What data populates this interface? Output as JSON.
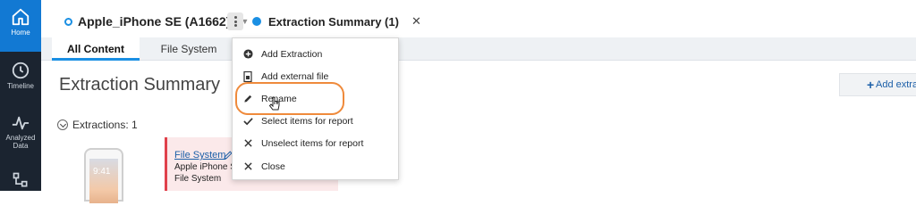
{
  "rail": {
    "items": [
      {
        "label": "Home",
        "icon": "home-icon",
        "active": true
      },
      {
        "label": "Timeline",
        "icon": "clock-icon",
        "active": false
      },
      {
        "label": "Analyzed Data",
        "icon": "pulse-icon",
        "active": false
      },
      {
        "label": "",
        "icon": "hierarchy-icon",
        "active": false
      }
    ]
  },
  "topbar": {
    "device_tab": "Apple_iPhone SE (A1662)",
    "summary_tab": "Extraction Summary (1)",
    "close": "✕"
  },
  "subtabs": {
    "all_content": "All Content",
    "file_system": "File System"
  },
  "main": {
    "title": "Extraction Summary",
    "add_button": "Add extra",
    "extractions_label": "Extractions: 1",
    "phone_time": "9:41"
  },
  "card": {
    "link": "File System",
    "line1": "Apple iPhone S",
    "line2": "File System"
  },
  "menu": {
    "items": [
      {
        "label": "Add Extraction",
        "icon": "plus-circle-icon"
      },
      {
        "label": "Add external file",
        "icon": "file-add-icon"
      },
      {
        "label": "Rename",
        "icon": "pencil-icon"
      },
      {
        "label": "Select items for report",
        "icon": "check-icon"
      },
      {
        "label": "Unselect items for report",
        "icon": "x-icon"
      },
      {
        "label": "Close",
        "icon": "x-icon"
      }
    ]
  },
  "colors": {
    "accent": "#1a8fe3",
    "rail_bg": "#1b2430",
    "rail_active": "#1279d3",
    "highlight_ring": "#ef8a3b",
    "card_border": "#e0414b"
  }
}
